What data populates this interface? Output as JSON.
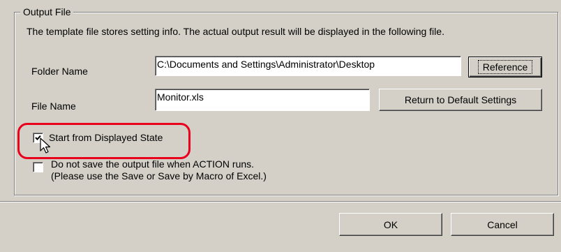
{
  "group": {
    "title": "Output File",
    "description": "The template file stores setting info. The actual output result will be displayed in the following file."
  },
  "folder": {
    "label": "Folder Name",
    "value": "C:\\Documents and Settings\\Administrator\\Desktop",
    "button": "Reference"
  },
  "file": {
    "label": "File Name",
    "value": "Monitor.xls",
    "button": "Return to Default Settings"
  },
  "options": {
    "start_displayed": {
      "label": "Start from Displayed State",
      "checked": true
    },
    "no_save": {
      "line1": "Do not save the output file when ACTION runs.",
      "line2": "(Please use the Save or Save by Macro of Excel.)",
      "checked": false
    }
  },
  "footer": {
    "ok": "OK",
    "cancel": "Cancel"
  },
  "colors": {
    "dialog_bg": "#d4d0c8",
    "highlight": "#e8001c"
  },
  "icons": {
    "cursor": "arrow-pointer-icon",
    "check": "check-mark-icon"
  }
}
